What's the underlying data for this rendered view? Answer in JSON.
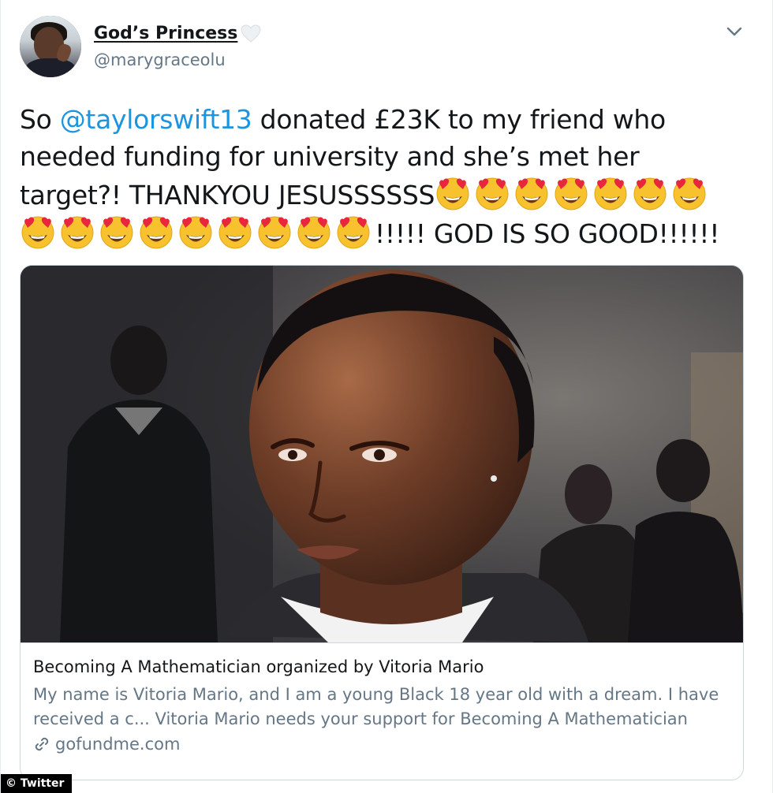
{
  "tweet": {
    "display_name": "God’s Princess",
    "handle": "@marygraceolu",
    "text_prefix": "So ",
    "mention": "@taylorswift13",
    "text_main": " donated £23K to my friend who needed funding for university and she’s met her target?! THANKYOU JESUSSSSSS",
    "text_suffix": "!!!!! GOD IS SO GOOD!!!!!!",
    "emoji_count": 16,
    "emoji_name": "smiling-face-with-heart-eyes",
    "name_heart_icon": "white-heart-icon",
    "menu_icon": "chevron-down-icon",
    "link_color": "#1b95e0"
  },
  "card": {
    "title": "Becoming A Mathematician organized by Vitoria Mario",
    "description": "My name is Vitoria Mario, and I am a young Black 18 year old with a dream. I have received a c... Vitoria Mario needs your support for Becoming A Mathematician",
    "domain": "gofundme.com",
    "link_icon": "link-icon"
  },
  "watermark": "© Twitter"
}
